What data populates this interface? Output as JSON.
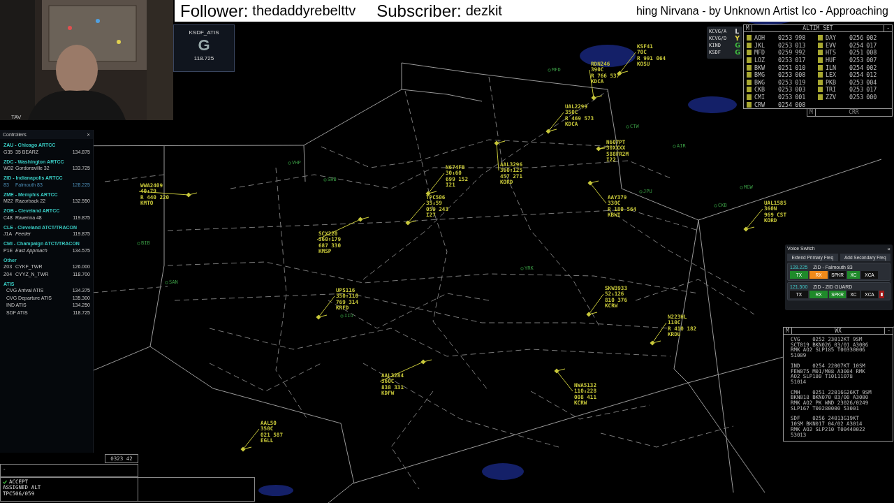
{
  "stream_overlay": {
    "follower_label": "Follower:",
    "follower": "thedaddyrebelttv",
    "subscriber_label": "Subscriber:",
    "subscriber": "dezkit",
    "now_playing": "hing Nirvana - by Unknown Artist Ico - Approaching"
  },
  "webcam": {
    "caption": "TAV"
  },
  "atis_box": {
    "title": "KSDF_ATIS",
    "code": "G",
    "frequency": "118.725"
  },
  "controllers": {
    "title": "Controllers",
    "close": "×",
    "groups": [
      {
        "name": "ZAU - Chicago ARTCC",
        "rows": [
          {
            "id": "G35",
            "name": "35 BEARZ",
            "freq": "134.875",
            "own": false,
            "secondary": false
          }
        ]
      },
      {
        "name": "ZDC - Washington ARTCC",
        "rows": [
          {
            "id": "W32",
            "name": "Gordonsville 32",
            "freq": "133.725",
            "own": false,
            "secondary": false
          }
        ]
      },
      {
        "name": "ZID - Indianapolis ARTCC",
        "rows": [
          {
            "id": "83",
            "name": "Falmouth 83",
            "freq": "128.225",
            "own": true,
            "secondary": false
          }
        ]
      },
      {
        "name": "ZME - Memphis ARTCC",
        "rows": [
          {
            "id": "M22",
            "name": "Razorback 22",
            "freq": "132.550",
            "own": false,
            "secondary": false
          }
        ]
      },
      {
        "name": "ZOB - Cleveland ARTCC",
        "rows": [
          {
            "id": "C48",
            "name": "Ravenna 48",
            "freq": "119.875",
            "own": false,
            "secondary": false
          }
        ]
      },
      {
        "name": "CLE - Cleveland ATCT/TRACON",
        "rows": [
          {
            "id": "J1A",
            "name": "Feeder",
            "freq": "119.875",
            "own": false,
            "secondary": true
          }
        ]
      },
      {
        "name": "CMI - Champaign ATCT/TRACON",
        "rows": [
          {
            "id": "P1E",
            "name": "East Approach",
            "freq": "134.575",
            "own": false,
            "secondary": true
          }
        ]
      },
      {
        "name": "Other",
        "rows": [
          {
            "id": "Z03",
            "name": "CYKF_TWR",
            "freq": "126.000",
            "own": false,
            "secondary": false
          },
          {
            "id": "Z04",
            "name": "CYYZ_N_TWR",
            "freq": "118.700",
            "own": false,
            "secondary": false
          }
        ]
      },
      {
        "name": "ATIS",
        "rows": [
          {
            "name": "CVG Arrival ATIS",
            "freq": "134.375",
            "own": false,
            "secondary": false
          },
          {
            "name": "CVG Departure ATIS",
            "freq": "135.300",
            "own": false,
            "secondary": false
          },
          {
            "name": "IND ATIS",
            "freq": "134.250",
            "own": false,
            "secondary": false
          },
          {
            "name": "SDF ATIS",
            "freq": "118.725",
            "own": false,
            "secondary": false
          }
        ]
      }
    ]
  },
  "airport_status": [
    {
      "airport": "KCVG/A",
      "code": "L",
      "color": "#d8d8d8"
    },
    {
      "airport": "KCVG/D",
      "code": "Y",
      "color": "#e0d040"
    },
    {
      "airport": "KIND",
      "code": "G",
      "color": "#40c040"
    },
    {
      "airport": "KSDF",
      "code": "G",
      "color": "#40c040"
    }
  ],
  "altimeters": {
    "menu": "M",
    "title": "ALTIM SET",
    "minimize": "-",
    "stations": [
      {
        "station": "AOH",
        "time": "0253",
        "value": "998"
      },
      {
        "station": "JKL",
        "time": "0253",
        "value": "013"
      },
      {
        "station": "MFD",
        "time": "0259",
        "value": "992"
      },
      {
        "station": "LOZ",
        "time": "0253",
        "value": "017"
      },
      {
        "station": "BKW",
        "time": "0251",
        "value": "010"
      },
      {
        "station": "BMG",
        "time": "0253",
        "value": "008"
      },
      {
        "station": "BWG",
        "time": "0253",
        "value": "019"
      },
      {
        "station": "CKB",
        "time": "0253",
        "value": "003"
      },
      {
        "station": "CMI",
        "time": "0253",
        "value": "001"
      },
      {
        "station": "CRW",
        "time": "0254",
        "value": "008"
      },
      {
        "station": "DAY",
        "time": "0256",
        "value": "002"
      },
      {
        "station": "EVV",
        "time": "0254",
        "value": "017"
      },
      {
        "station": "HTS",
        "time": "0251",
        "value": "008"
      },
      {
        "station": "HUF",
        "time": "0253",
        "value": "007"
      },
      {
        "station": "ILN",
        "time": "0254",
        "value": "002"
      },
      {
        "station": "LEX",
        "time": "0254",
        "value": "012"
      },
      {
        "station": "PKB",
        "time": "0253",
        "value": "004"
      },
      {
        "station": "TRI",
        "time": "0253",
        "value": "017"
      },
      {
        "station": "ZZV",
        "time": "0253",
        "value": "000"
      }
    ]
  },
  "crr_bar": {
    "menu": "M",
    "title": "CRR"
  },
  "voice_switch": {
    "title": "Voice Switch",
    "close": "×",
    "actions": [
      "Extend Primary Freq",
      "Add Secondary Freq"
    ],
    "channels": [
      {
        "frequency": "128.225",
        "name": "ZID - Falmouth 83",
        "deletable": false,
        "buttons": [
          {
            "label": "TX",
            "on": true,
            "color": "#1f8a2a"
          },
          {
            "label": "RX",
            "on": true,
            "color": "#f08a1a"
          },
          {
            "label": "SPKR",
            "on": false
          },
          {
            "label": "XC",
            "on": true,
            "color": "#1f8a2a"
          },
          {
            "label": "XCA",
            "on": false
          }
        ]
      },
      {
        "frequency": "121.500",
        "name": "ZID - ZID GUARD",
        "deletable": true,
        "buttons": [
          {
            "label": "TX",
            "on": false
          },
          {
            "label": "RX",
            "on": true,
            "color": "#1f8a2a"
          },
          {
            "label": "SPKR",
            "on": true,
            "color": "#1f8a2a"
          },
          {
            "label": "XC",
            "on": false
          },
          {
            "label": "XCA",
            "on": false
          }
        ]
      }
    ]
  },
  "wx": {
    "menu": "M",
    "title": "WX",
    "minimize": "-",
    "reports": [
      [
        "CVG    0252 23012KT 9SM",
        "SCT019 BKN026 03/01 A3006",
        "RMK AO2 SLP185 T00330006",
        "51009"
      ],
      [
        "IND    0254 22007KT 10SM",
        "FEW075 M01/M08 A3004 RMK",
        "AO2 SLP180 T10111078",
        "51014"
      ],
      [
        "CMH    0251 22016G26KT 9SM",
        "BKN018 BKN070 03/00 A3000",
        "RMK AO2 PK WND 23026/0249",
        "SLP167 T00280000 53001"
      ],
      [
        "SDF    0256 24013G19KT",
        "10SM BKN017 04/02 A3014",
        "RMK AO2 SLP210 T00440022",
        "53013"
      ]
    ]
  },
  "radar": {
    "fixes": [
      "VHP",
      "SHB",
      "BIB",
      "SAN",
      "IIU",
      "YRK",
      "MFD",
      "CTW",
      "AIR",
      "JPU",
      "MGW",
      "CKB"
    ],
    "aircraft": [
      {
        "lines": [
          "KSF41",
          "70C",
          "R 991 064",
          "KOSU"
        ]
      },
      {
        "lines": [
          "RDN246",
          "390C",
          "R 766 537",
          "KDCA"
        ]
      },
      {
        "lines": [
          "UAL2299",
          "350C",
          "R 469 573",
          "KDCA"
        ]
      },
      {
        "lines": [
          "N607PT",
          "30XXXX",
          "588FR2M",
          "I22"
        ]
      },
      {
        "lines": [
          "AAY379",
          "330C",
          "R 180 564",
          "KBWI"
        ]
      },
      {
        "lines": [
          "UAL1585",
          "360N",
          "969 CST",
          "KORD"
        ]
      },
      {
        "lines": [
          "N674FB",
          "30↓60",
          "699 152",
          "I21"
        ]
      },
      {
        "lines": [
          "AAL3296",
          "360↑125",
          "457 271",
          "KORD"
        ]
      },
      {
        "lines": [
          "TPC506",
          "35↓59",
          "059 243",
          "I27"
        ]
      },
      {
        "lines": [
          "WWA2409",
          "40↓79",
          "R 440 220",
          "KMTO"
        ]
      },
      {
        "lines": [
          "SCX220",
          "360↑179",
          "687 330",
          "KMSP"
        ]
      },
      {
        "lines": [
          "UPS116",
          "350↑110",
          "769 314",
          "KRFD"
        ]
      },
      {
        "lines": [
          "SKW3933",
          "52↓126",
          "810 376",
          "KCRW"
        ]
      },
      {
        "lines": [
          "N223HL",
          "110C",
          "R 410 182",
          "KRDU"
        ]
      },
      {
        "lines": [
          "AAL3284",
          "360C",
          "838 331",
          "KDFW"
        ]
      },
      {
        "lines": [
          "NWA5132",
          "110↓228",
          "008 411",
          "KCRW"
        ]
      },
      {
        "lines": [
          "AAL50",
          "350C",
          "021 587",
          "EGLL"
        ]
      }
    ]
  },
  "time_box": "0323 42",
  "command_line": "-",
  "response": {
    "accepted": true,
    "lines": [
      "ACCEPT",
      "ASSIGNED ALT",
      "TPC506/059"
    ]
  }
}
